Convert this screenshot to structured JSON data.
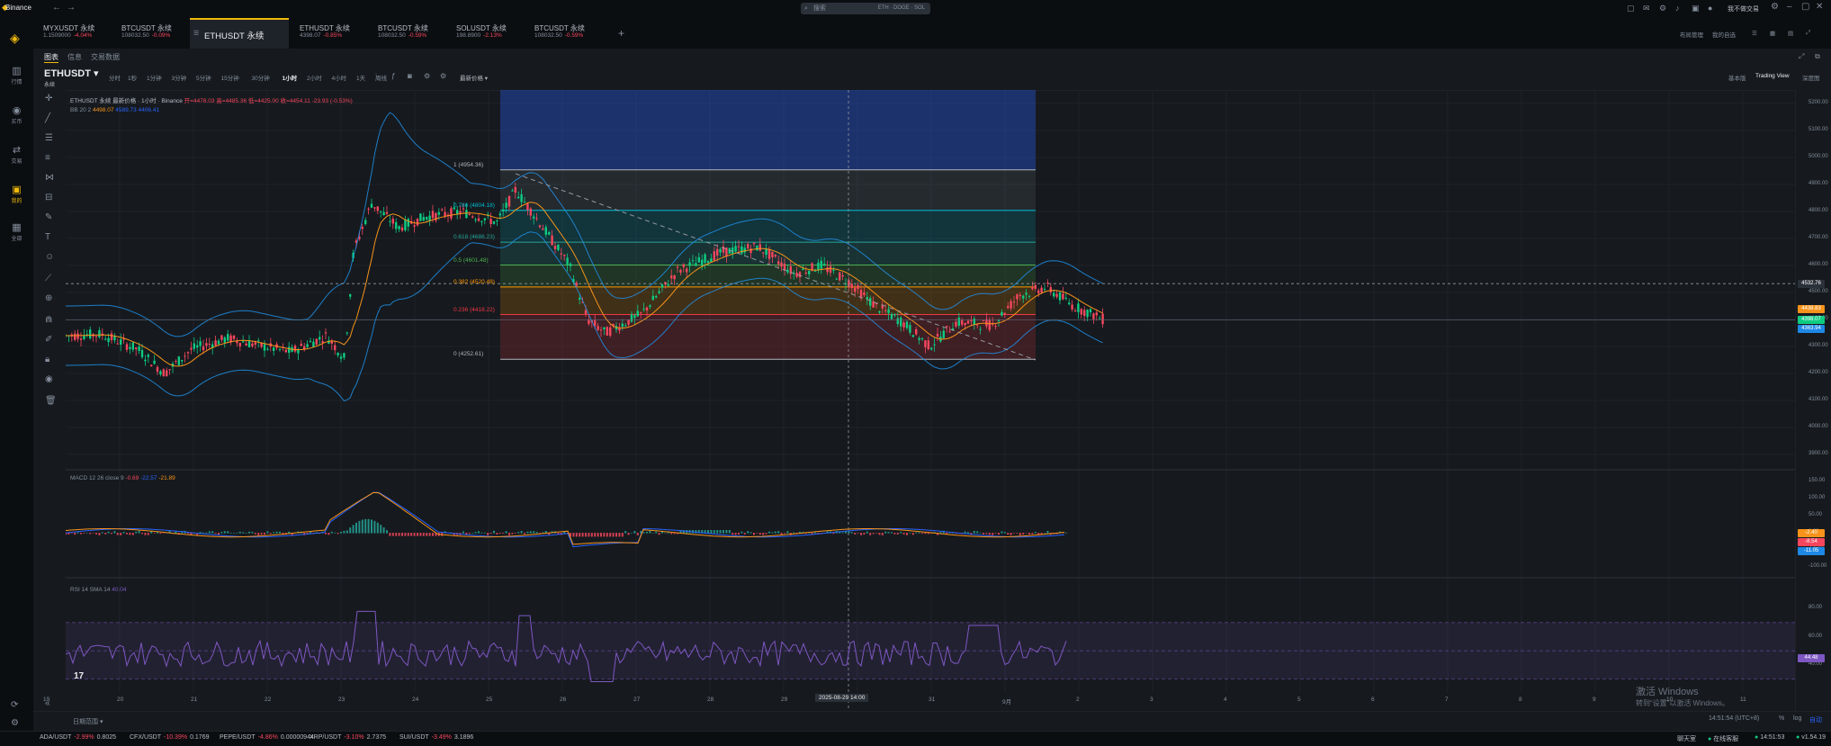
{
  "app": {
    "name": "Binance"
  },
  "search": {
    "placeholder": "搜索",
    "hint": "ETH · DOGE · SOL"
  },
  "user": {
    "label": "我不做交易"
  },
  "sidebar": [
    {
      "label": "行情",
      "icon": "bar-chart-icon",
      "glyph": "▥"
    },
    {
      "label": "买币",
      "icon": "coin-icon",
      "glyph": "◉"
    },
    {
      "label": "交易",
      "icon": "trade-icon",
      "glyph": "⇄"
    },
    {
      "label": "我的",
      "icon": "wallet-icon",
      "glyph": "▣"
    },
    {
      "label": "全部",
      "icon": "grid-icon",
      "glyph": "▦"
    }
  ],
  "tabs": [
    {
      "name": "MYXUSDT 永续",
      "price": "1.1509000",
      "change": "-4.04%"
    },
    {
      "name": "BTCUSDT 永续",
      "price": "108032.50",
      "change": "-0.09%"
    },
    {
      "name": "ETHUSDT 永续",
      "price": "",
      "change": ""
    },
    {
      "name": "ETHUSDT 永续",
      "price": "4398.07",
      "change": "-0.85%"
    },
    {
      "name": "BTCUSDT 永续",
      "price": "108032.50",
      "change": "-0.59%"
    },
    {
      "name": "SOLUSDT 永续",
      "price": "198.8900",
      "change": "-2.13%"
    },
    {
      "name": "BTCUSDT 永续",
      "price": "108032.50",
      "change": "-0.59%"
    }
  ],
  "tabs_right": {
    "layout": "布局管理",
    "mine": "我的自选"
  },
  "subtabs": [
    "图表",
    "信息",
    "交易数据"
  ],
  "symbol": {
    "name": "ETHUSDT",
    "type": "永续"
  },
  "intervals": [
    "分时",
    "1秒",
    "1分钟",
    "3分钟",
    "5分钟",
    "15分钟",
    "30分钟",
    "1小时",
    "2小时",
    "4小时",
    "1天",
    "周线"
  ],
  "latest_price_label": "最新价格",
  "view_modes": [
    "基本版",
    "Trading View",
    "深度图"
  ],
  "legend": {
    "main": "ETHUSDT 永续 最新价格 · 1小时 · Binance",
    "open": "开=4478.03",
    "high": "高=4485.36",
    "low": "低=4425.00",
    "close": "收=4454.11",
    "change": "-23.93 (-0.53%)",
    "bb_label": "BB 20 2",
    "bb_values": [
      "4498.07",
      "4589.73",
      "4406.41"
    ],
    "macd_label": "MACD 12 26 close 9",
    "macd_values": [
      "-0.69",
      "-22.57",
      "-21.89"
    ],
    "rsi_label": "RSI 14 SMA 14",
    "rsi_value": "40.04"
  },
  "fib_levels": [
    {
      "label": "1 (4954.36)",
      "price": 4954.36,
      "color": "#b2b5be"
    },
    {
      "label": "0.786 (4804.18)",
      "price": 4804.18,
      "color": "#00bcd4"
    },
    {
      "label": "0.618 (4686.23)",
      "price": 4686.23,
      "color": "#26a69a"
    },
    {
      "label": "0.5 (4601.48)",
      "price": 4601.48,
      "color": "#4caf50"
    },
    {
      "label": "0.382 (4520.48)",
      "price": 4520.48,
      "color": "#ff9800"
    },
    {
      "label": "0.236 (4418.22)",
      "price": 4418.22,
      "color": "#f23645"
    },
    {
      "label": "0 (4252.61)",
      "price": 4252.61,
      "color": "#b2b5be"
    }
  ],
  "price_axis": [
    "5200.00",
    "5100.00",
    "5000.00",
    "4900.00",
    "4800.00",
    "4700.00",
    "4600.00",
    "4500.00",
    "4400.00",
    "4300.00",
    "4200.00",
    "4100.00",
    "4000.00",
    "3900.00"
  ],
  "price_tags": [
    {
      "text": "4532.76",
      "color": "#2b3139"
    },
    {
      "text": "4438.83",
      "color": "#f7931a"
    },
    {
      "text": "4398.07",
      "color": "#0ecb81"
    },
    {
      "text": "4363.94",
      "color": "#1e88e5"
    }
  ],
  "macd_axis": [
    "150.00",
    "100.00",
    "50.00",
    "0.00",
    "-50.00",
    "-100.00"
  ],
  "macd_tags": [
    {
      "text": "-2.40",
      "color": "#f7931a"
    },
    {
      "text": "-8.54",
      "color": "#f6465d"
    },
    {
      "text": "-11.05",
      "color": "#1e88e5"
    }
  ],
  "rsi_axis": [
    "80.00",
    "60.00",
    "40.00"
  ],
  "rsi_tag": "44.48",
  "x_axis": [
    "19",
    "20",
    "21",
    "22",
    "23",
    "24",
    "25",
    "26",
    "27",
    "28",
    "29",
    "30",
    "31",
    "9月",
    "2",
    "3",
    "4",
    "5",
    "6",
    "7",
    "8",
    "9",
    "10",
    "11"
  ],
  "crosshair_label": "2025-08-29  14:00",
  "range_label": "日期范围",
  "tickers": [
    {
      "sym": "ADA/USDT",
      "chg": "-2.99%",
      "price": "0.8025"
    },
    {
      "sym": "CFX/USDT",
      "chg": "-10.39%",
      "price": "0.1769"
    },
    {
      "sym": "PEPE/USDT",
      "chg": "-4.86%",
      "price": "0.00000944"
    },
    {
      "sym": "XRP/USDT",
      "chg": "-3.10%",
      "price": "2.7375"
    },
    {
      "sym": "SUI/USDT",
      "chg": "-3.49%",
      "price": "3.1896"
    }
  ],
  "footer_right": {
    "announce": "聊天室",
    "online": "在线客服",
    "time": "14:51:53",
    "version": "v1.54.19"
  },
  "axis_footer": {
    "time": "14:51:54 (UTC+8)",
    "pct": "%",
    "log": "log",
    "auto": "自动"
  },
  "watermark": {
    "line1": "激活 Windows",
    "line2": "转到“设置”以激活 Windows。"
  }
}
